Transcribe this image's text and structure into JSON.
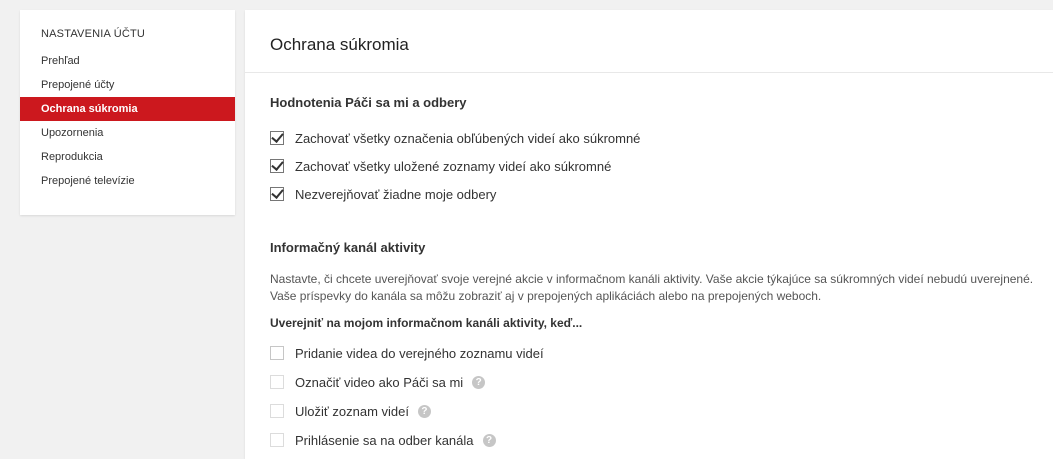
{
  "sidebar": {
    "heading": "NASTAVENIA ÚČTU",
    "items": [
      {
        "label": "Prehľad"
      },
      {
        "label": "Prepojené účty"
      },
      {
        "label": "Ochrana súkromia"
      },
      {
        "label": "Upozornenia"
      },
      {
        "label": "Reprodukcia"
      },
      {
        "label": "Prepojené televízie"
      }
    ],
    "active_index": 2
  },
  "main": {
    "title": "Ochrana súkromia",
    "likes_section": {
      "title": "Hodnotenia Páči sa mi a odbery",
      "options": [
        {
          "label": "Zachovať všetky označenia obľúbených videí ako súkromné",
          "checked": true
        },
        {
          "label": "Zachovať všetky uložené zoznamy videí ako súkromné",
          "checked": true
        },
        {
          "label": "Nezverejňovať žiadne moje odbery",
          "checked": true
        }
      ]
    },
    "activity_section": {
      "title": "Informačný kanál aktivity",
      "description": "Nastavte, či chcete uverejňovať svoje verejné akcie v informačnom kanáli aktivity. Vaše akcie týkajúce sa súkromných videí nebudú uverejnené. Vaše príspevky do kanála sa môžu zobraziť aj v prepojených aplikáciách alebo na prepojených weboch.",
      "subheading": "Uverejniť na mojom informačnom kanáli aktivity, keď...",
      "options": [
        {
          "label": "Pridanie videa do verejného zoznamu videí",
          "checked": false,
          "help": false
        },
        {
          "label": "Označiť video ako Páči sa mi",
          "checked": false,
          "help": true
        },
        {
          "label": "Uložiť zoznam videí",
          "checked": false,
          "help": true
        },
        {
          "label": "Prihlásenie sa na odber kanála",
          "checked": false,
          "help": true
        }
      ]
    },
    "help_icon_glyph": "?"
  },
  "colors": {
    "accent": "#cc181e",
    "background": "#f1f1f1"
  }
}
